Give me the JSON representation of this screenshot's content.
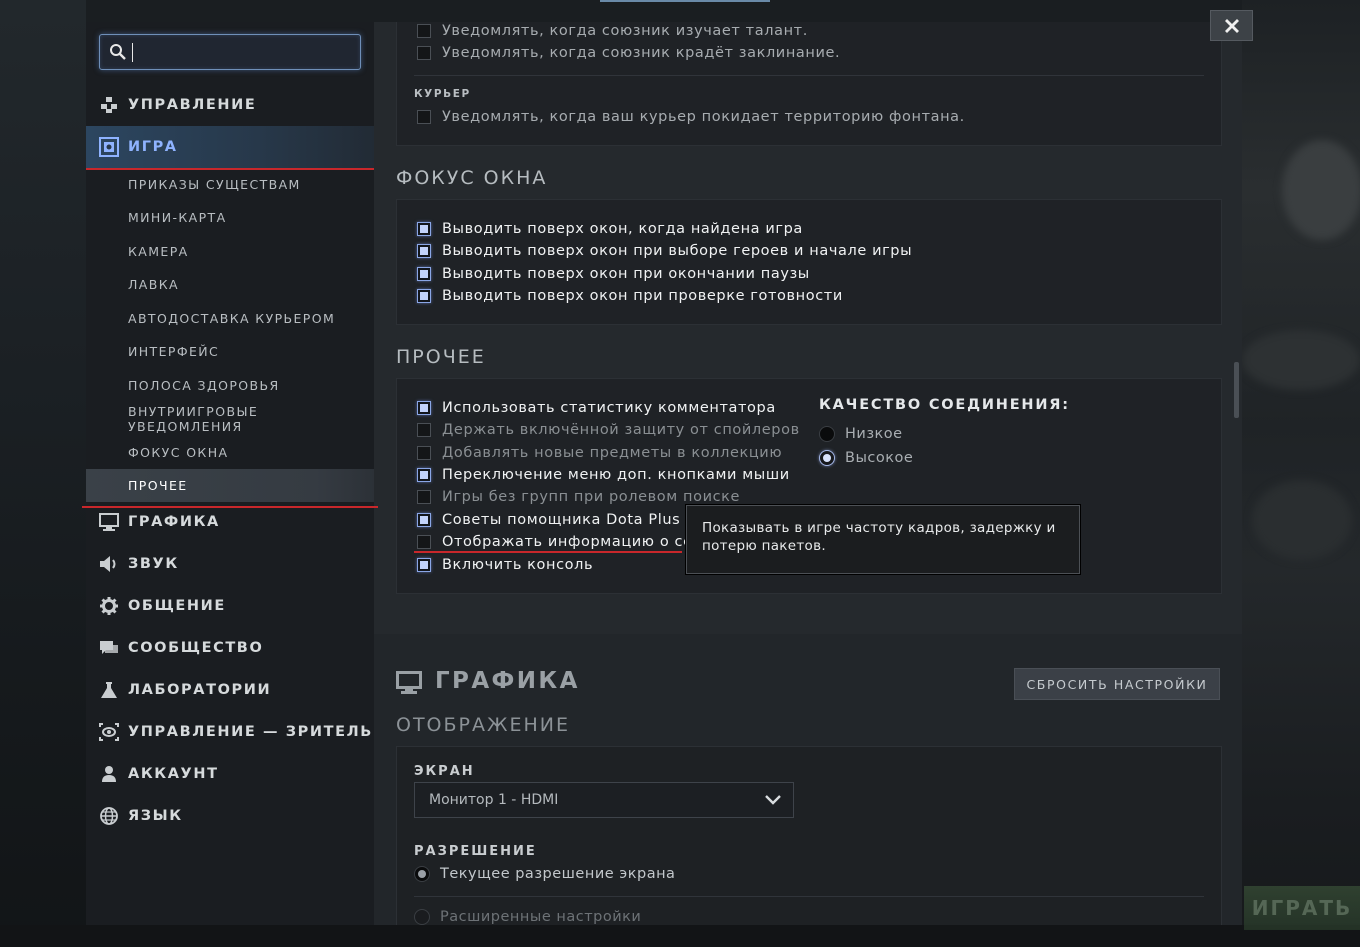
{
  "search": {
    "value": "",
    "placeholder": ""
  },
  "sidebar": {
    "items": [
      {
        "label": "УПРАВЛЕНИЕ",
        "icon": "controls-icon"
      },
      {
        "label": "ИГРА",
        "icon": "game-icon"
      },
      {
        "label": "ГРАФИКА",
        "icon": "monitor-icon"
      },
      {
        "label": "ЗВУК",
        "icon": "speaker-icon"
      },
      {
        "label": "ОБЩЕНИЕ",
        "icon": "gear-icon"
      },
      {
        "label": "СООБЩЕСТВО",
        "icon": "chat-icon"
      },
      {
        "label": "ЛАБОРАТОРИИ",
        "icon": "flask-icon"
      },
      {
        "label": "УПРАВЛЕНИЕ — ЗРИТЕЛЬ",
        "icon": "eye-icon"
      },
      {
        "label": "АККАУНТ",
        "icon": "user-icon"
      },
      {
        "label": "ЯЗЫК",
        "icon": "globe-icon"
      }
    ],
    "game_subitems": [
      "ПРИКАЗЫ СУЩЕСТВАМ",
      "МИНИ-КАРТА",
      "КАМЕРА",
      "ЛАВКА",
      "АВТОДОСТАВКА КУРЬЕРОМ",
      "ИНТЕРФЕЙС",
      "ПОЛОСА ЗДОРОВЬЯ",
      "ВНУТРИИГРОВЫЕ УВЕДОМЛЕНИЯ",
      "ФОКУС ОКНА",
      "ПРОЧЕЕ"
    ],
    "active_item": "ИГРА",
    "selected_subitem": "ПРОЧЕЕ"
  },
  "notifications": {
    "top_items": [
      {
        "label": "Уведомлять, когда союзник изучает талант.",
        "checked": false
      },
      {
        "label": "Уведомлять, когда союзник крадёт заклинание.",
        "checked": false
      }
    ],
    "courier_label": "КУРЬЕР",
    "courier_item": {
      "label": "Уведомлять, когда ваш курьер покидает территорию фонтана.",
      "checked": false
    }
  },
  "window_focus": {
    "title": "ФОКУС ОКНА",
    "items": [
      {
        "label": "Выводить поверх окон, когда найдена игра",
        "checked": true
      },
      {
        "label": "Выводить поверх окон при выборе героев и начале игры",
        "checked": true
      },
      {
        "label": "Выводить поверх окон при окончании паузы",
        "checked": true
      },
      {
        "label": "Выводить поверх окон при проверке готовности",
        "checked": true
      }
    ]
  },
  "other": {
    "title": "ПРОЧЕЕ",
    "items": [
      {
        "label": "Использовать статистику комментатора",
        "checked": true
      },
      {
        "label": "Держать включённой защиту от спойлеров",
        "checked": false
      },
      {
        "label": "Добавлять новые предметы в коллекцию",
        "checked": false
      },
      {
        "label": "Переключение меню доп. кнопками мыши",
        "checked": true
      },
      {
        "label": "Игры без групп при ролевом поиске",
        "checked": false
      },
      {
        "label": "Советы помощника Dota Plus вмес",
        "checked": true
      },
      {
        "label": "Отображать информацию о сети",
        "checked": false
      },
      {
        "label": "Включить консоль",
        "checked": true
      }
    ],
    "connection_quality": {
      "title": "КАЧЕСТВО СОЕДИНЕНИЯ:",
      "options": [
        "Низкое",
        "Высокое"
      ],
      "selected": "Высокое"
    },
    "tooltip": "Показывать в игре частоту кадров, задержку и потерю пакетов."
  },
  "graphics": {
    "title": "ГРАФИКА",
    "reset_label": "СБРОСИТЬ НАСТРОЙКИ",
    "display_title": "ОТОБРАЖЕНИЕ",
    "screen_label": "ЭКРАН",
    "screen_value": "Монитор 1 - HDMI",
    "resolution_label": "РАЗРЕШЕНИЕ",
    "resolution_options": [
      "Текущее разрешение экрана",
      "Расширенные настройки"
    ],
    "resolution_selected": "Текущее разрешение экрана"
  },
  "background": {
    "play_button": "ИГРАТЬ"
  },
  "colors": {
    "accent": "#8fb3ff",
    "highlight_red": "#c8272b"
  }
}
